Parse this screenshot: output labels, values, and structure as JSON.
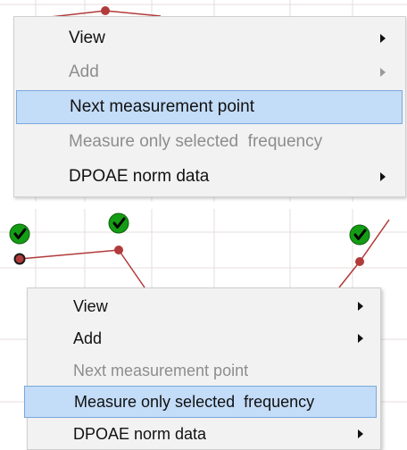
{
  "context_menu_top": {
    "items": [
      {
        "label": "View",
        "state": "enabled",
        "has_submenu": true
      },
      {
        "label": "Add",
        "state": "disabled",
        "has_submenu": true
      },
      {
        "label": "Next measurement point",
        "state": "highlighted",
        "has_submenu": false
      },
      {
        "label": "Measure only selected  frequency",
        "state": "disabled",
        "has_submenu": false
      },
      {
        "label": "DPOAE norm data",
        "state": "enabled",
        "has_submenu": true
      }
    ]
  },
  "context_menu_bottom": {
    "items": [
      {
        "label": "View",
        "state": "enabled",
        "has_submenu": true
      },
      {
        "label": "Add",
        "state": "enabled",
        "has_submenu": true
      },
      {
        "label": "Next measurement point",
        "state": "disabled",
        "has_submenu": false
      },
      {
        "label": "Measure only selected  frequency",
        "state": "highlighted",
        "has_submenu": false
      },
      {
        "label": "DPOAE norm data",
        "state": "enabled",
        "has_submenu": true
      }
    ]
  },
  "graph": {
    "point_count": 4,
    "measured_marker_count": 3,
    "measured_marker_icon": "check-icon",
    "marker_color": "#149c14",
    "line_color": "#b23a3a",
    "grid_color": "#e7dede"
  },
  "colors": {
    "menu_background": "#f2f2f2",
    "highlight_fill": "#c3dcf8",
    "highlight_border": "#7aa8dc",
    "disabled_text": "#8d8d8d"
  }
}
